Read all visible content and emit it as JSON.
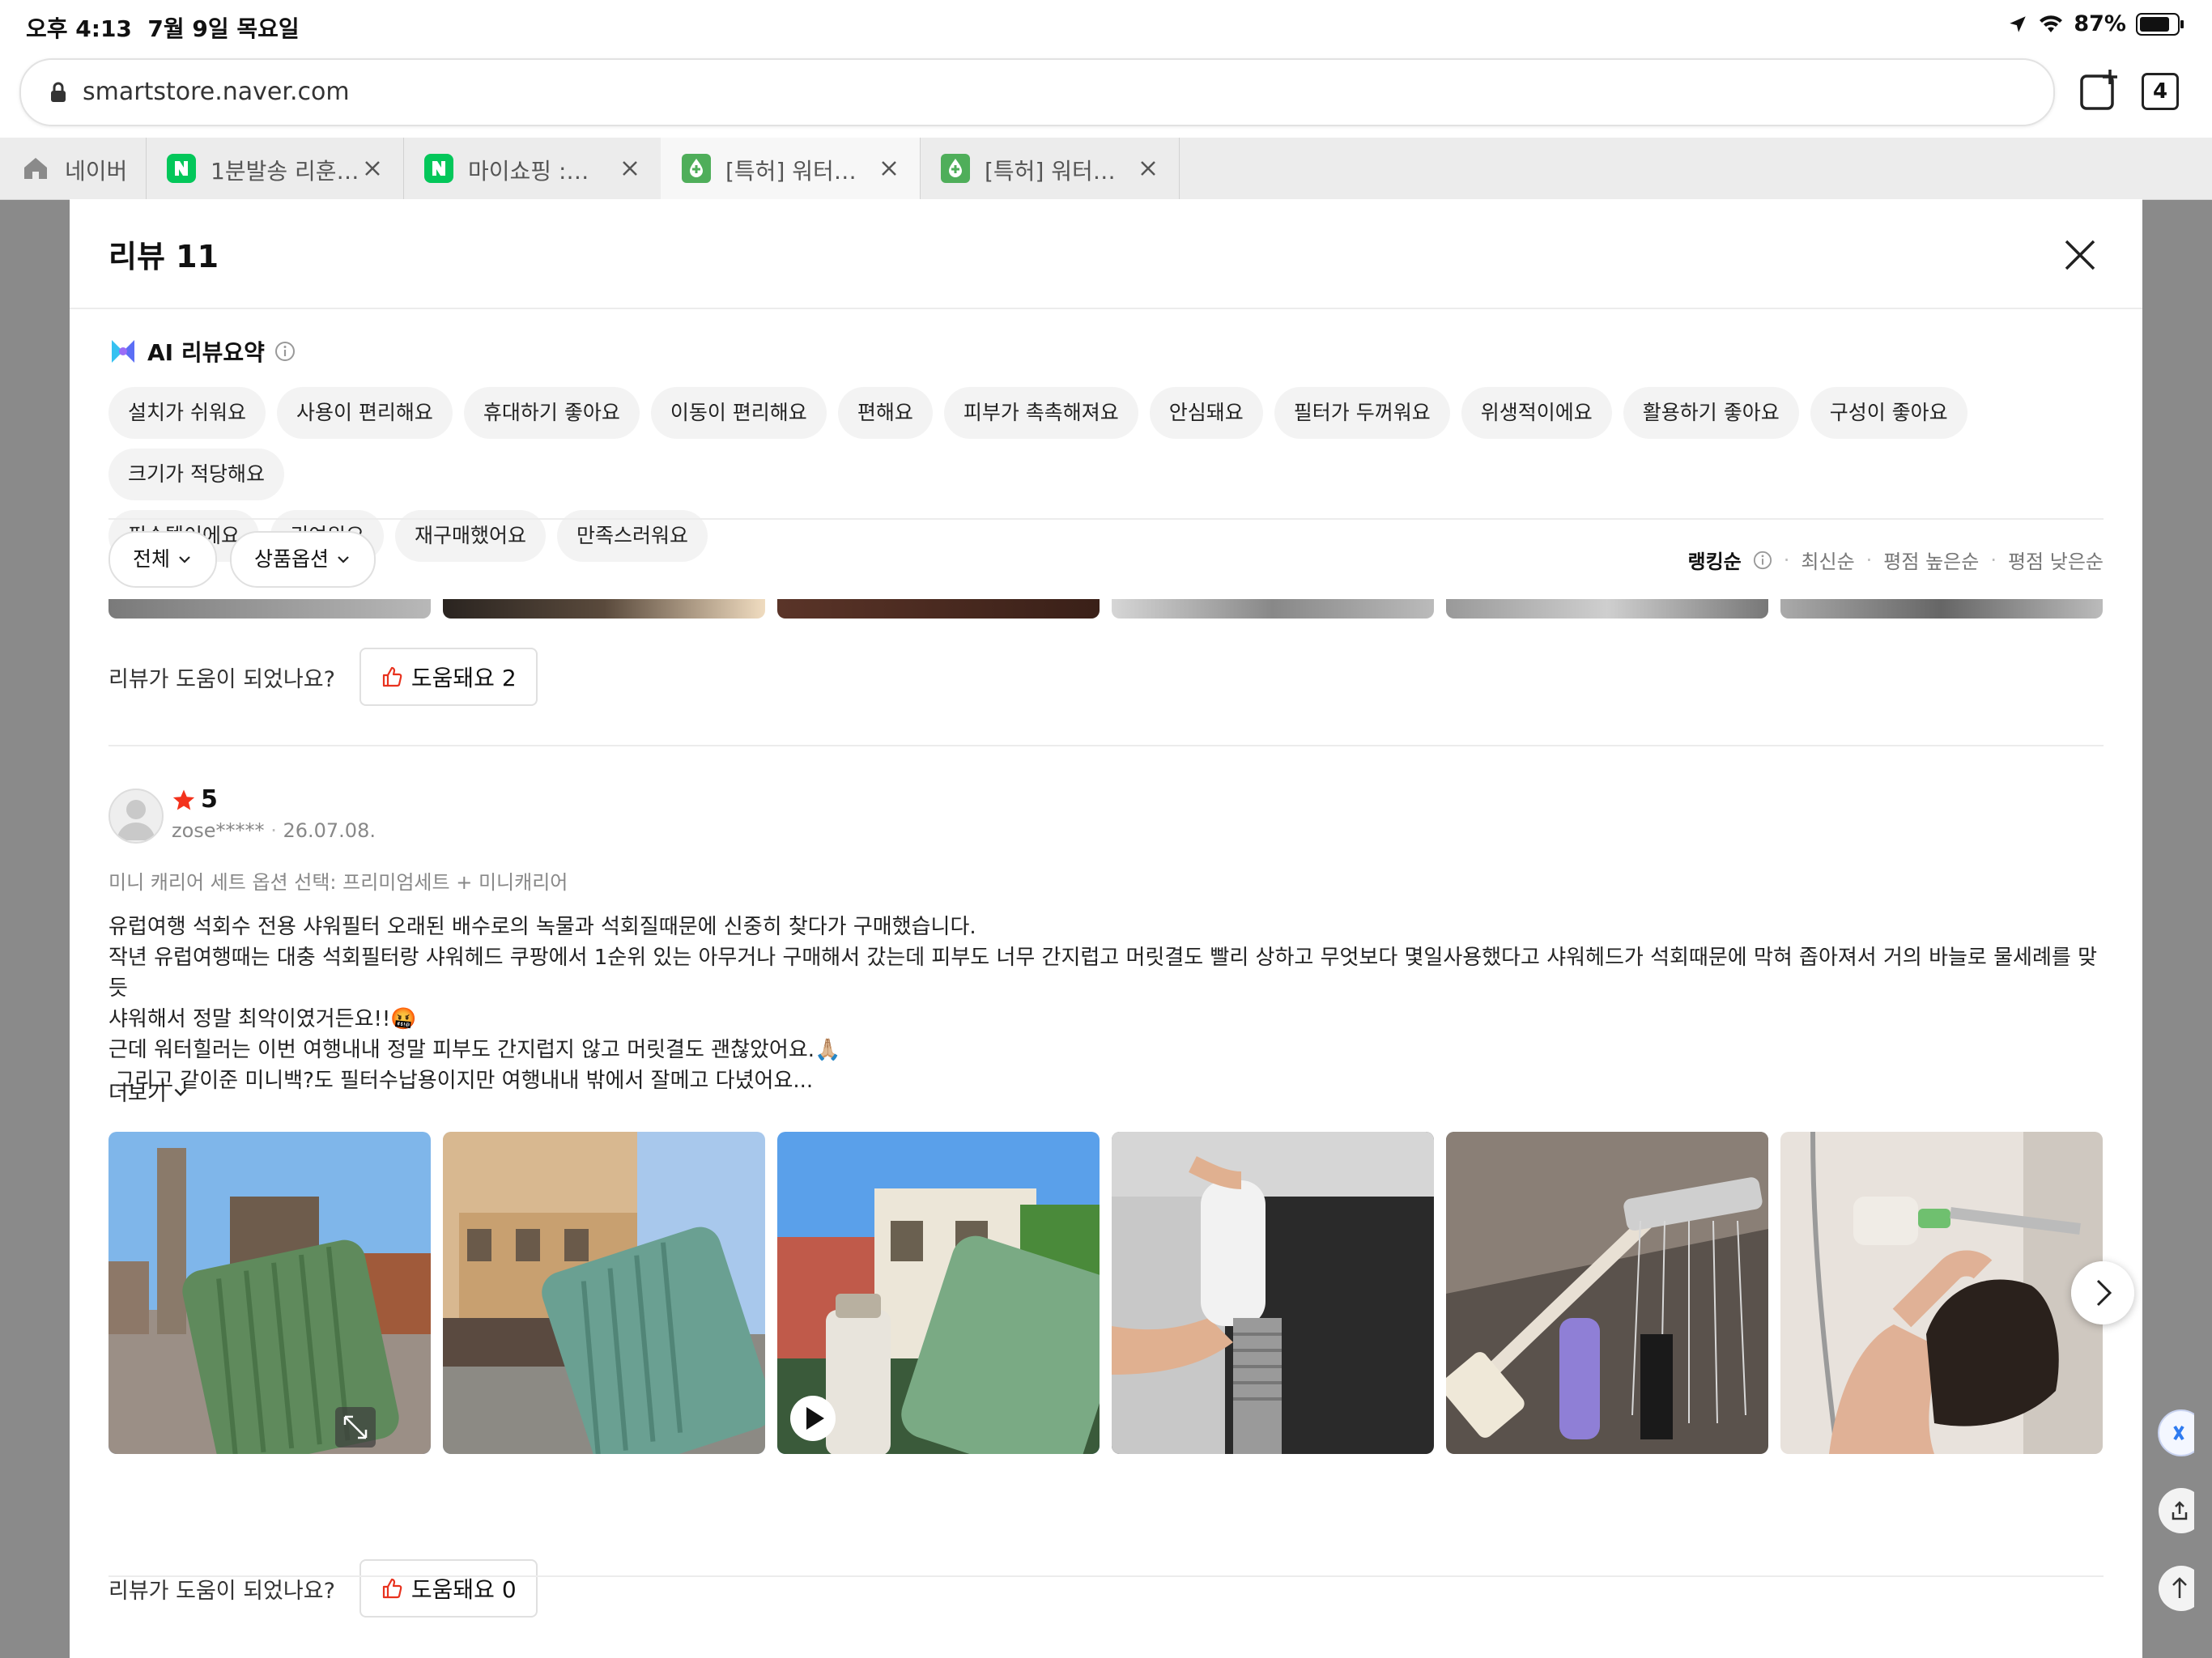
{
  "status_bar": {
    "time": "오후 4:13",
    "date": "7월 9일 목요일",
    "battery": "87%"
  },
  "browser": {
    "url": "smartstore.naver.com",
    "tab_count": "4",
    "tabs": [
      {
        "label": "네이버",
        "icon": "home-icon"
      },
      {
        "label": "1분발송 리훈…",
        "icon": "naver-n-icon"
      },
      {
        "label": "마이쇼핑 :…",
        "icon": "naver-n-icon"
      },
      {
        "label": "[특허] 워터…",
        "icon": "green-drop-icon"
      },
      {
        "label": "[특허] 워터…",
        "icon": "green-drop-icon"
      }
    ]
  },
  "modal": {
    "title": "리뷰 11",
    "ai_summary": {
      "title": "AI 리뷰요약",
      "chips": [
        "설치가 쉬워요",
        "사용이 편리해요",
        "휴대하기 좋아요",
        "이동이 편리해요",
        "편해요",
        "피부가 촉촉해져요",
        "안심돼요",
        "필터가 두꺼워요",
        "위생적이에요",
        "활용하기 좋아요",
        "구성이 좋아요",
        "크기가 적당해요",
        "필수템이에요",
        "귀여워요",
        "재구매했어요",
        "만족스러워요"
      ]
    },
    "filters": {
      "all": "전체",
      "option": "상품옵션"
    },
    "sort": {
      "ranking": "랭킹순",
      "latest": "최신순",
      "high": "평점 높은순",
      "low": "평점 낮은순"
    },
    "prev_review": {
      "helpful_question": "리뷰가 도움이 되었나요?",
      "helpful_button": "도움돼요 2"
    },
    "review": {
      "rating": "5",
      "user": "zose*****",
      "date": "26.07.08.",
      "option": "미니 캐리어 세트 옵션 선택: 프리미엄세트 + 미니캐리어",
      "lines": [
        "유럽여행 석회수 전용 샤워필터 오래된 배수로의 녹물과 석회질때문에 신중히 찾다가 구매했습니다.",
        "작년 유럽여행때는 대충 석회필터랑 샤워헤드 쿠팡에서 1순위 있는 아무거나 구매해서 갔는데 피부도 너무 간지럽고 머릿결도 빨리 상하고 무엇보다 몇일사용했다고 샤워헤드가 석회때문에 막혀 좁아져서 거의 바늘로 물세례를 맞듯",
        "샤워해서 정말 최악이였거든요!!🤬",
        "근데 워터힐러는 이번 여행내내 정말 피부도 간지럽지 않고 머릿결도 괜찮았어요.🙏🏼",
        " 그리고 같이준 미니백?도 필터수납용이지만 여행내내 밖에서 잘메고 다녔어요..."
      ],
      "more": "더보기",
      "helpful_question": "리뷰가 도움이 되었나요?",
      "helpful_button": "도움돼요 0"
    }
  }
}
